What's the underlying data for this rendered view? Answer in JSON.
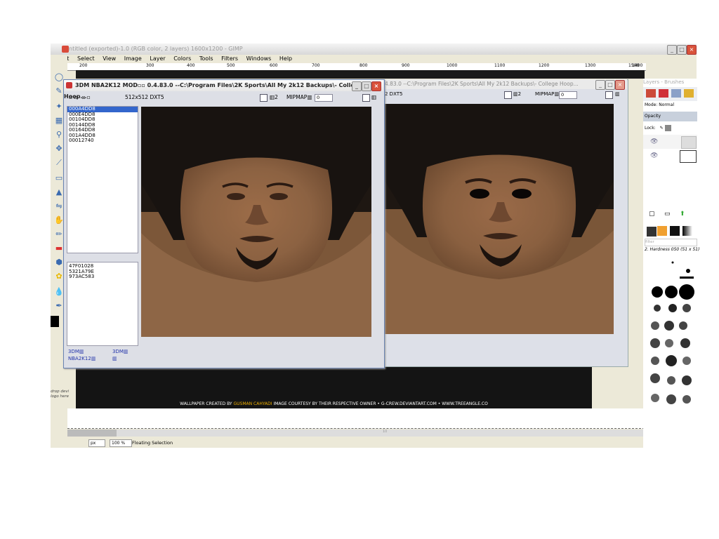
{
  "gimp": {
    "title": "ntitled (exported)-1.0 (RGB color, 2 layers) 1600x1200 - GIMP",
    "menu": [
      "dit",
      "Select",
      "View",
      "Image",
      "Layer",
      "Colors",
      "Tools",
      "Filters",
      "Windows",
      "Help"
    ],
    "ruler_ticks": [
      "200",
      "300",
      "400",
      "500",
      "600",
      "700",
      "800",
      "900",
      "1000",
      "1100",
      "1200",
      "1300",
      "1400",
      "1500"
    ],
    "drop_hint": "drop devi\nlogo here",
    "status_unit": "px",
    "status_zoom": "100 %",
    "status_text": "Floating Selection",
    "scroll_label": "10"
  },
  "wallpaper_credit": {
    "prefix": "WALLPAPER CREATED BY ",
    "author": "GUSMAN CAHYADI",
    "suffix": " IMAGE COURTESY BY THEIR RESPECTIVE OWNER • G-CREW.DEVIANTART.COM • WWW.TREEANGLE.CO"
  },
  "tool_window_front": {
    "title": "3DM NBA2K12 MOD▫▫ 0.4.83.0 --C:\\Program Files\\2K Sports\\All My 2k12 Backups\\- College Hoop...",
    "tool_icons": "▫▫ ▫▫",
    "format": "512x512 DXT5",
    "option_label": "▥2",
    "mipmap_label": "MIPMAP▥",
    "mipmap_value": "0",
    "list_top": [
      "000A4DD8",
      "000E4DD8",
      "00104DD8",
      "00144DD8",
      "00164DD8",
      "001A4DD8",
      "00012740"
    ],
    "list_bottom": [
      "47F01028",
      "5321A79E",
      "973AC583"
    ],
    "footer_left": [
      "3DM▥",
      "NBA2K12▥"
    ],
    "footer_right": [
      "3DM▥",
      "▥"
    ]
  },
  "tool_window_back": {
    "title": "4.83.0 --C:\\Program Files\\2K Sports\\All My 2k12 Backups\\- College Hoop...",
    "format": "2 DXT5",
    "option_label": "▥2",
    "mipmap_label": "MIPMAP▥",
    "mipmap_value": "0"
  },
  "panel": {
    "title": "Layers - Brushes",
    "mode": "Mode: Normal",
    "opacity": "Opacity",
    "lock": "Lock:",
    "filter_placeholder": "filter",
    "brush_name": "2. Hardness 050 (51 x 51)"
  }
}
